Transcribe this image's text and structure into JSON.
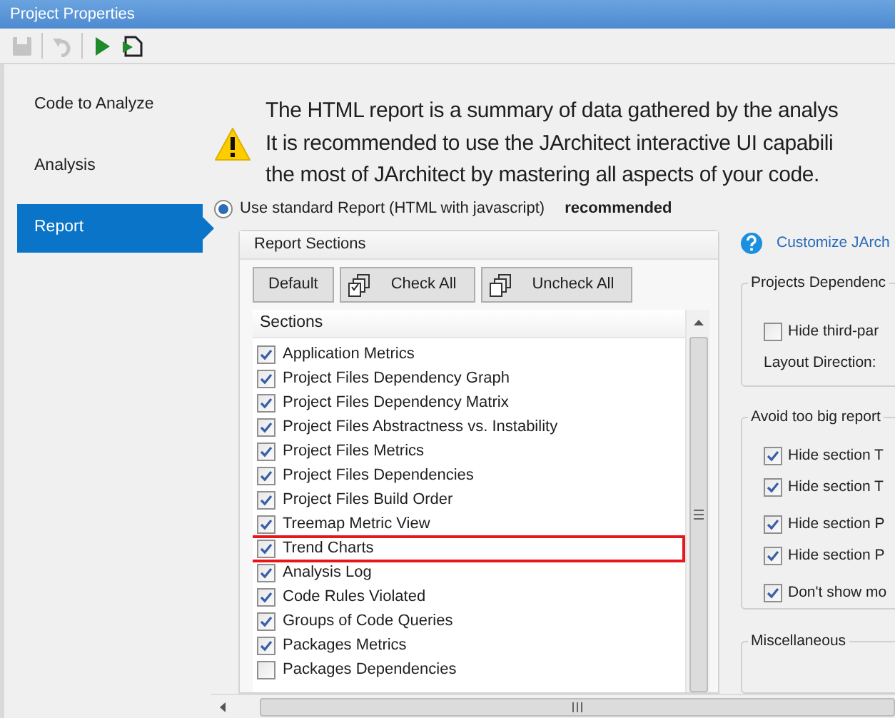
{
  "window": {
    "title": "Project Properties"
  },
  "toolbar": [
    {
      "kind": "save",
      "disabled": true
    },
    {
      "kind": "undo",
      "disabled": true
    },
    {
      "kind": "run",
      "disabled": false
    },
    {
      "kind": "export",
      "disabled": false
    }
  ],
  "sidebar": {
    "items": [
      {
        "label": "Code to Analyze",
        "selected": false
      },
      {
        "label": "Analysis",
        "selected": false
      },
      {
        "label": "Report",
        "selected": true
      }
    ]
  },
  "intro": [
    "The HTML report is a summary of data gathered by the analys",
    "It is recommended to use the JArchitect interactive UI capabili",
    "the most of JArchitect by mastering all aspects of your code."
  ],
  "report_option": {
    "label": "Use standard Report (HTML with javascript)",
    "note": "recommended",
    "selected": true
  },
  "report_sections": {
    "title": "Report Sections",
    "buttons": [
      {
        "kind": "plain",
        "label": "Default"
      },
      {
        "kind": "check",
        "label": "Check All"
      },
      {
        "kind": "uncheck",
        "label": "Uncheck All"
      }
    ],
    "header": "Sections",
    "items": [
      {
        "label": "Application Metrics",
        "checked": true,
        "highlighted": false
      },
      {
        "label": "Project Files Dependency Graph",
        "checked": true,
        "highlighted": false
      },
      {
        "label": "Project Files Dependency Matrix",
        "checked": true,
        "highlighted": false
      },
      {
        "label": "Project Files Abstractness vs. Instability",
        "checked": true,
        "highlighted": false
      },
      {
        "label": "Project Files Metrics",
        "checked": true,
        "highlighted": false
      },
      {
        "label": "Project Files Dependencies",
        "checked": true,
        "highlighted": false
      },
      {
        "label": "Project Files Build Order",
        "checked": true,
        "highlighted": false
      },
      {
        "label": "Treemap Metric View",
        "checked": true,
        "highlighted": false
      },
      {
        "label": "Trend Charts",
        "checked": true,
        "highlighted": true
      },
      {
        "label": "Analysis Log",
        "checked": true,
        "highlighted": false
      },
      {
        "label": "Code Rules Violated",
        "checked": true,
        "highlighted": false
      },
      {
        "label": "Groups of Code Queries",
        "checked": true,
        "highlighted": false
      },
      {
        "label": "Packages Metrics",
        "checked": true,
        "highlighted": false
      },
      {
        "label": "Packages Dependencies",
        "checked": false,
        "highlighted": false
      }
    ]
  },
  "customize_link": "Customize JArch",
  "projects_dependencies": {
    "title": "Projects Dependenc",
    "hide_third_party": {
      "label": "Hide third-par",
      "checked": false
    },
    "layout_direction_label": "Layout Direction:"
  },
  "avoid_big_report": {
    "title": "Avoid too big report",
    "options": [
      {
        "label": "Hide section T",
        "checked": true
      },
      {
        "label": "Hide section T",
        "checked": true
      },
      {
        "label": "Hide section P",
        "checked": true
      },
      {
        "label": "Hide section P",
        "checked": true
      },
      {
        "label": "Don't show mo",
        "checked": true
      }
    ]
  },
  "miscellaneous": {
    "title": "Miscellaneous"
  }
}
